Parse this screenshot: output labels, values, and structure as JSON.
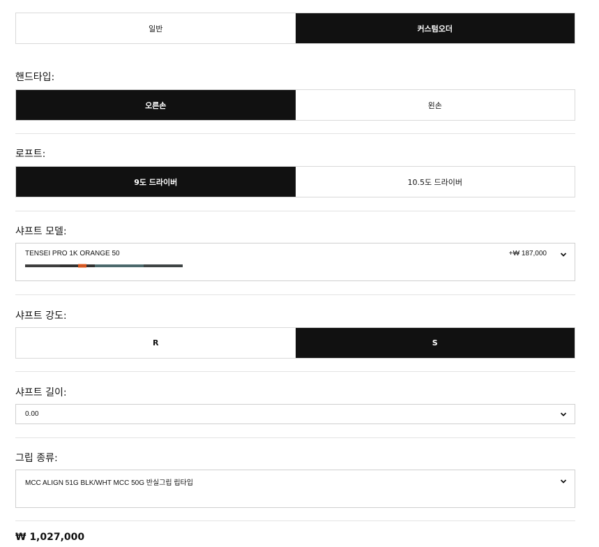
{
  "order_type": {
    "options": [
      "일반",
      "커스텀오더"
    ],
    "selected": "커스텀오더"
  },
  "hand": {
    "label": "핸드타입:",
    "options": [
      "오른손",
      "왼손"
    ],
    "selected": "오른손"
  },
  "loft": {
    "label": "로프트:",
    "options": [
      "9도 드라이버",
      "10.5도 드라이버"
    ],
    "selected": "9도 드라이버"
  },
  "shaft_model": {
    "label": "샤프트 모델:",
    "value": "TENSEI PRO 1K ORANGE 50",
    "price": "+₩ 187,000"
  },
  "shaft_flex": {
    "label": "샤프트 강도:",
    "options": [
      "R",
      "S"
    ],
    "selected": "S"
  },
  "shaft_length": {
    "label": "샤프트 길이:",
    "value": "0.00"
  },
  "grip": {
    "label": "그립 종류:",
    "value": "MCC ALIGN 51G BLK/WHT MCC 50G 반실그립 립타입"
  },
  "total_price": "₩ 1,027,000",
  "icons": {
    "dropdown": "chevron-down-icon"
  }
}
